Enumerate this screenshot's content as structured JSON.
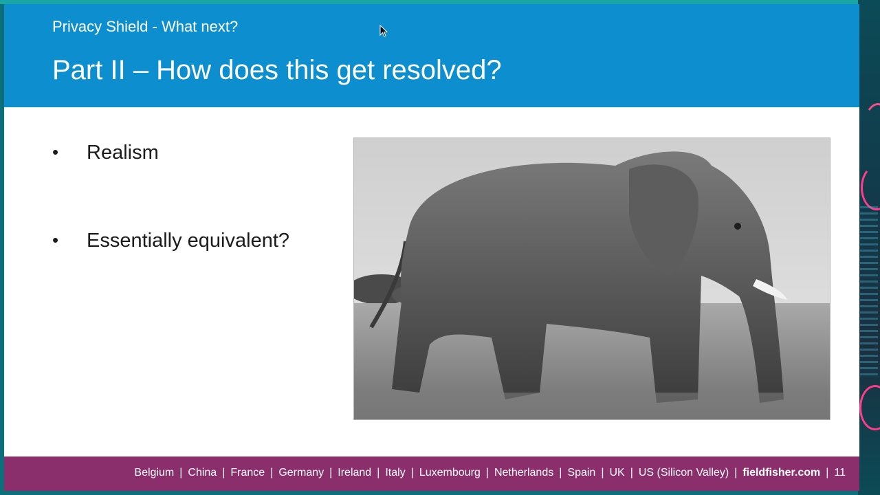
{
  "slide": {
    "subtitle": "Privacy Shield - What next?",
    "title": "Part II – How does this get resolved?",
    "bullets": [
      {
        "marker": "•",
        "text": "Realism"
      },
      {
        "marker": "•",
        "text": "Essentially equivalent?"
      }
    ],
    "image": {
      "icon": "elephant-photo"
    }
  },
  "footer": {
    "offices": [
      "Belgium",
      "China",
      "France",
      "Germany",
      "Ireland",
      "Italy",
      "Luxembourg",
      "Netherlands",
      "Spain",
      "UK",
      "US (Silicon Valley)"
    ],
    "separator": "|",
    "website": "fieldfisher.com",
    "page_number": "11"
  },
  "colors": {
    "header": "#0d8ecf",
    "footer": "#8a2f6c",
    "frame": "#0d6f7a"
  }
}
